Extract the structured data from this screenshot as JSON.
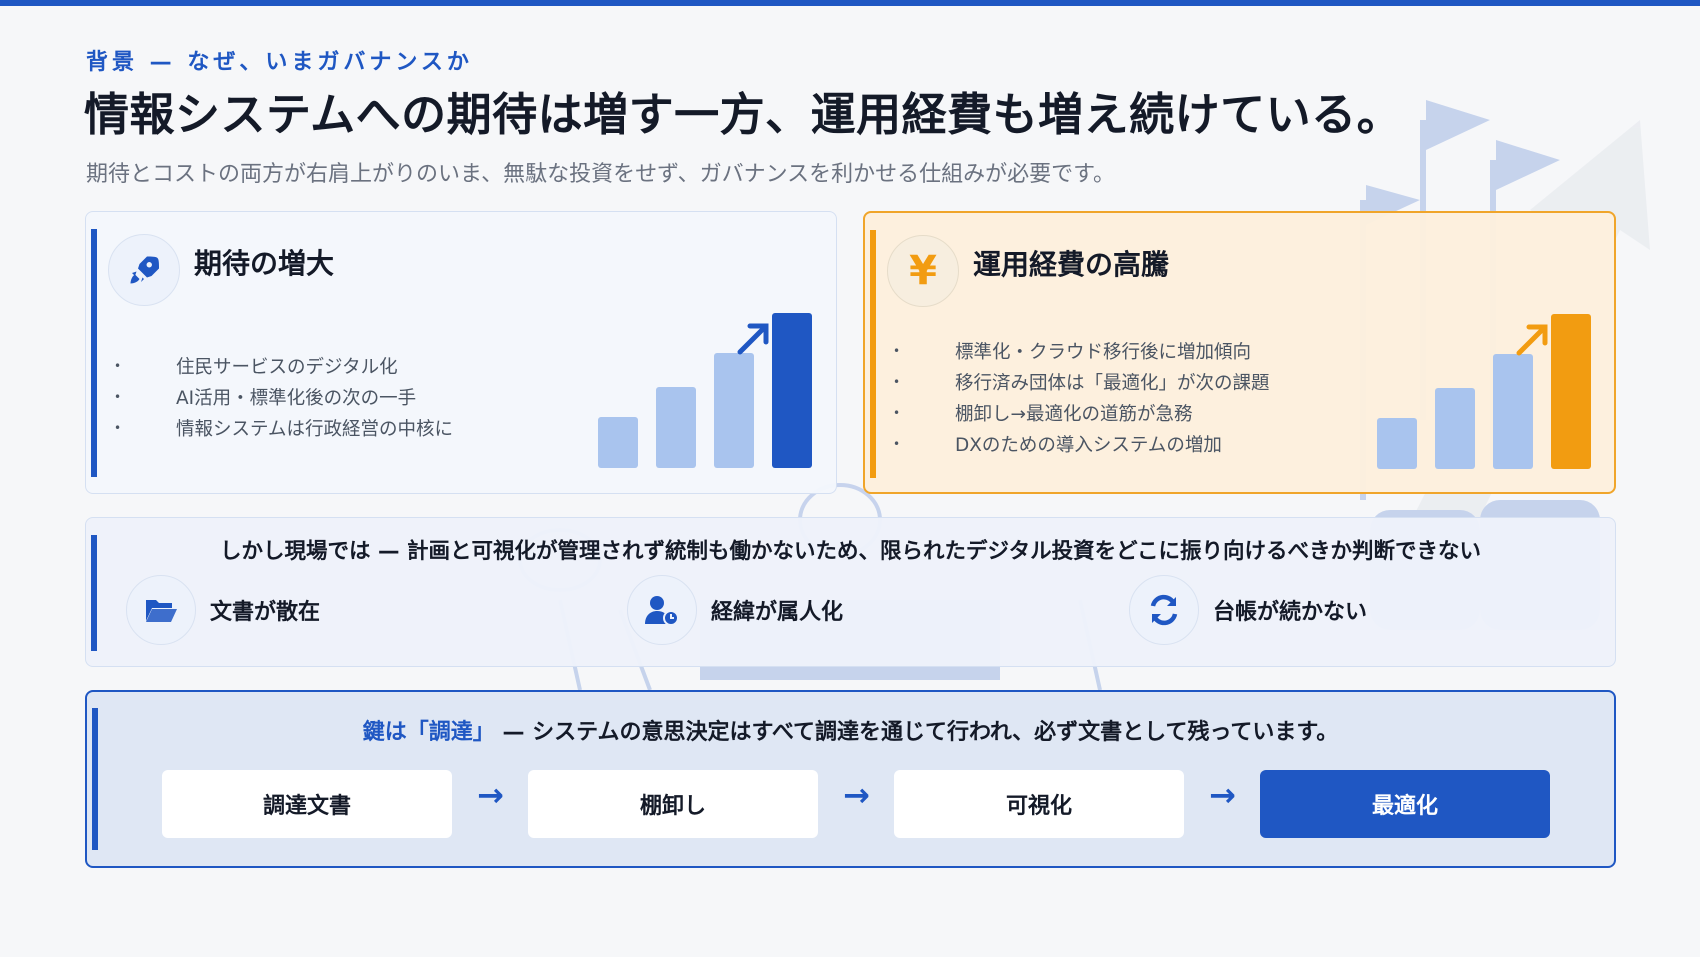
{
  "header": {
    "eyebrow": "背景 — なぜ、いまガバナンスか",
    "title": "情報システムへの期待は増す一方、運用経費も増え続けている。",
    "subtitle": "期待とコストの両方が右肩上がりのいま、無駄な投資をせず、ガバナンスを利かせる仕組みが必要です。"
  },
  "cards": [
    {
      "title": "期待の増大",
      "icon": "rocket-icon",
      "bullets": [
        "住民サービスのデジタル化",
        "AI活用・標準化後の次の一手",
        "情報システムは行政経営の中核に"
      ],
      "chart_levels": [
        0.33,
        0.52,
        0.74,
        1.0
      ]
    },
    {
      "title": "運用経費の高騰",
      "icon": "yen-icon",
      "icon_glyph": "¥",
      "bullets": [
        "標準化・クラウド移行後に増加傾向",
        "移行済み団体は「最適化」が次の課題",
        "棚卸し→最適化の道筋が急務",
        "DXのための導入システムの増加"
      ],
      "chart_levels": [
        0.33,
        0.52,
        0.74,
        1.0
      ]
    }
  ],
  "issues": {
    "headline": "しかし現場では — 計画と可視化が管理されず統制も働かないため、限られたデジタル投資をどこに振り向けるべきか判断できない",
    "items": [
      {
        "label": "文書が散在",
        "icon": "folder-open-icon"
      },
      {
        "label": "経緯が属人化",
        "icon": "user-clock-icon"
      },
      {
        "label": "台帳が続かない",
        "icon": "sync-icon"
      }
    ]
  },
  "key": {
    "highlight": "鍵は「調達」",
    "text": " — システムの意思決定はすべて調達を通じて行われ、必ず文書として残っています。",
    "steps": [
      "調達文書",
      "棚卸し",
      "可視化",
      "最適化"
    ],
    "arrow": "→"
  },
  "colors": {
    "brand_blue": "#1f57c3",
    "light_blue": "#a9c4ee",
    "orange": "#f29c11"
  }
}
